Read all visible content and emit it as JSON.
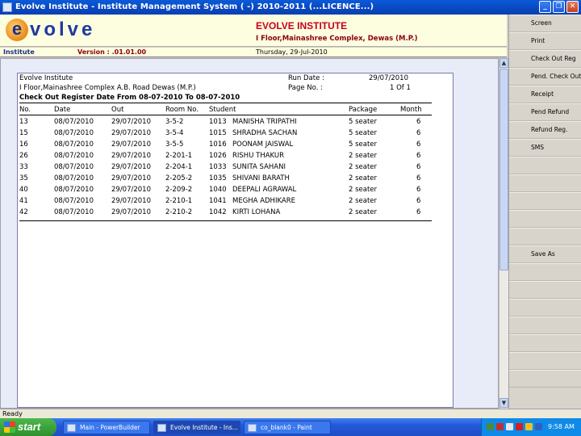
{
  "window": {
    "title": "Evolve Institute - Institute Management System ( -) 2010-2011 (...LICENCE...)",
    "minimize": "_",
    "maximize": "❐",
    "close": "✕"
  },
  "header": {
    "logo_letter": "e",
    "logo_text": "volve",
    "institute_name": "EVOLVE INSTITUTE",
    "institute_address": "I Floor,Mainashree Complex, Dewas (M.P.)",
    "module_label": "Institute",
    "version": "Version : .01.01.00",
    "date": "Thursday, 29-Jul-2010"
  },
  "report": {
    "org": "Evolve Institute",
    "address": "I Floor,Mainashree Complex A.B. Road Dewas (M.P.)",
    "run_date_label": "Run Date :",
    "run_date": "29/07/2010",
    "page_label": "Page No. :",
    "page_value": "1 Of 1",
    "title": "Check Out Register Date From 08-07-2010 To 08-07-2010",
    "columns": [
      "No.",
      "Date",
      "Out",
      "Room No.",
      "Student",
      "Package",
      "Month"
    ],
    "rows": [
      {
        "no": "13",
        "date": "08/07/2010",
        "out": "29/07/2010",
        "room": "3-5-2",
        "id": "1013",
        "name": "MANISHA  TRIPATHI",
        "package": "5 seater",
        "month": "6"
      },
      {
        "no": "15",
        "date": "08/07/2010",
        "out": "29/07/2010",
        "room": "3-5-4",
        "id": "1015",
        "name": "SHRADHA  SACHAN",
        "package": "5 seater",
        "month": "6"
      },
      {
        "no": "16",
        "date": "08/07/2010",
        "out": "29/07/2010",
        "room": "3-5-5",
        "id": "1016",
        "name": "POONAM  JAISWAL",
        "package": "5 seater",
        "month": "6"
      },
      {
        "no": "26",
        "date": "08/07/2010",
        "out": "29/07/2010",
        "room": "2-201-1",
        "id": "1026",
        "name": "RISHU  THAKUR",
        "package": "2 seater",
        "month": "6"
      },
      {
        "no": "33",
        "date": "08/07/2010",
        "out": "29/07/2010",
        "room": "2-204-1",
        "id": "1033",
        "name": "SUNITA  SAHANI",
        "package": "2 seater",
        "month": "6"
      },
      {
        "no": "35",
        "date": "08/07/2010",
        "out": "29/07/2010",
        "room": "2-205-2",
        "id": "1035",
        "name": "SHIVANI  BARATH",
        "package": "2 seater",
        "month": "6"
      },
      {
        "no": "40",
        "date": "08/07/2010",
        "out": "29/07/2010",
        "room": "2-209-2",
        "id": "1040",
        "name": "DEEPALI  AGRAWAL",
        "package": "2 seater",
        "month": "6"
      },
      {
        "no": "41",
        "date": "08/07/2010",
        "out": "29/07/2010",
        "room": "2-210-1",
        "id": "1041",
        "name": "MEGHA  ADHIKARE",
        "package": "2 seater",
        "month": "6"
      },
      {
        "no": "42",
        "date": "08/07/2010",
        "out": "29/07/2010",
        "room": "2-210-2",
        "id": "1042",
        "name": "KIRTI  LOHANA",
        "package": "2 seater",
        "month": "6"
      }
    ]
  },
  "sidebar": {
    "buttons": [
      "Screen",
      "Print",
      "Check Out Reg",
      "Pend. Check Out",
      "Receipt",
      "Pend Refund",
      "Refund Reg.",
      "SMS",
      "",
      "",
      "",
      "",
      "",
      "Save As",
      "",
      "",
      "",
      "",
      "",
      "",
      ""
    ]
  },
  "scrollbar": {
    "up": "▲",
    "down": "▼"
  },
  "status": {
    "text": "Ready"
  },
  "taskbar": {
    "start": "start",
    "tasks": [
      "Main - PowerBuilder",
      "Evolve Institute - Ins...",
      "co_blank0 - Paint"
    ],
    "clock": "9:58 AM"
  }
}
